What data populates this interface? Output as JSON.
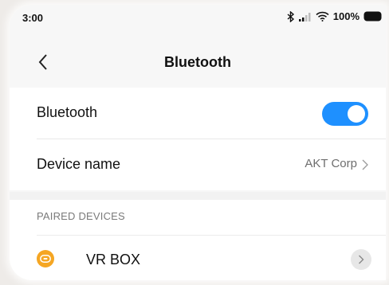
{
  "status_bar": {
    "time": "3:00",
    "battery": "100%",
    "icons": [
      "bluetooth-icon",
      "signal-icon",
      "wifi-icon",
      "battery-icon"
    ]
  },
  "header": {
    "title": "Bluetooth",
    "back_icon": "chevron-left-icon"
  },
  "settings": {
    "bluetooth": {
      "label": "Bluetooth",
      "enabled": true
    },
    "device_name": {
      "label": "Device name",
      "value": "AKT Corp"
    }
  },
  "paired": {
    "section_title": "PAIRED DEVICES",
    "devices": [
      {
        "name": "VR BOX",
        "icon": "gamepad-icon"
      }
    ]
  },
  "colors": {
    "accent": "#1e90ff",
    "device_icon": "#f5a623",
    "background": "#f7f7f7"
  }
}
